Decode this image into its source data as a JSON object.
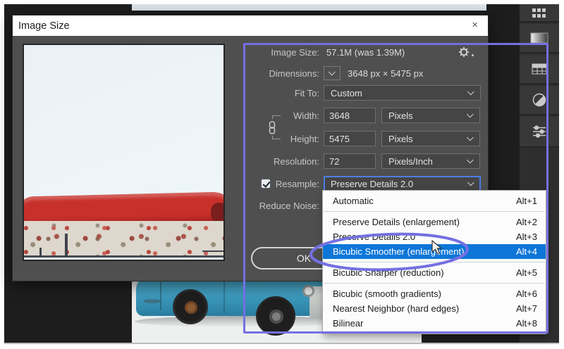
{
  "window": {
    "title": "Image Size",
    "close_glyph": "×"
  },
  "panel": {
    "image_size": {
      "label": "Image Size:",
      "value": "57.1M (was 1.39M)"
    },
    "dimensions": {
      "label": "Dimensions:",
      "value": "3648 px  ×  5475 px"
    },
    "fit_to": {
      "label": "Fit To:",
      "value": "Custom"
    },
    "width": {
      "label": "Width:",
      "value": "3648",
      "unit": "Pixels"
    },
    "height": {
      "label": "Height:",
      "value": "5475",
      "unit": "Pixels"
    },
    "resolution": {
      "label": "Resolution:",
      "value": "72",
      "unit": "Pixels/Inch"
    },
    "resample": {
      "label": "Resample:",
      "value": "Preserve Details 2.0",
      "checked": true
    },
    "reduce_noise": {
      "label": "Reduce Noise:"
    },
    "ok_label": "OK"
  },
  "menu": {
    "items": [
      {
        "label": "Automatic",
        "shortcut": "Alt+1",
        "selected": false,
        "sep_after": true
      },
      {
        "label": "Preserve Details (enlargement)",
        "shortcut": "Alt+2",
        "selected": false,
        "sep_after": false
      },
      {
        "label": "Preserve Details 2.0",
        "shortcut": "Alt+3",
        "selected": false,
        "sep_after": false
      },
      {
        "label": "Bicubic Smoother (enlargement)",
        "shortcut": "Alt+4",
        "selected": true,
        "sep_after": true
      },
      {
        "label": "Bicubic Sharper (reduction)",
        "shortcut": "Alt+5",
        "selected": false,
        "sep_after": true
      },
      {
        "label": "Bicubic (smooth gradients)",
        "shortcut": "Alt+6",
        "selected": false,
        "sep_after": false
      },
      {
        "label": "Nearest Neighbor (hard edges)",
        "shortcut": "Alt+7",
        "selected": false,
        "sep_after": false
      },
      {
        "label": "Bilinear",
        "shortcut": "Alt+8",
        "selected": false,
        "sep_after": false
      }
    ]
  },
  "toolbar": {
    "icons": [
      "pattern-icon",
      "gradient-icon",
      "grid-icon",
      "contrast-icon",
      "sliders-icon"
    ]
  },
  "colors": {
    "annotation_purple": "#7470e2",
    "menu_highlight": "#0d76d8",
    "focus_blue": "#4d7de8",
    "car_blue": "#3b98bb",
    "sled_red": "#c8302b"
  }
}
